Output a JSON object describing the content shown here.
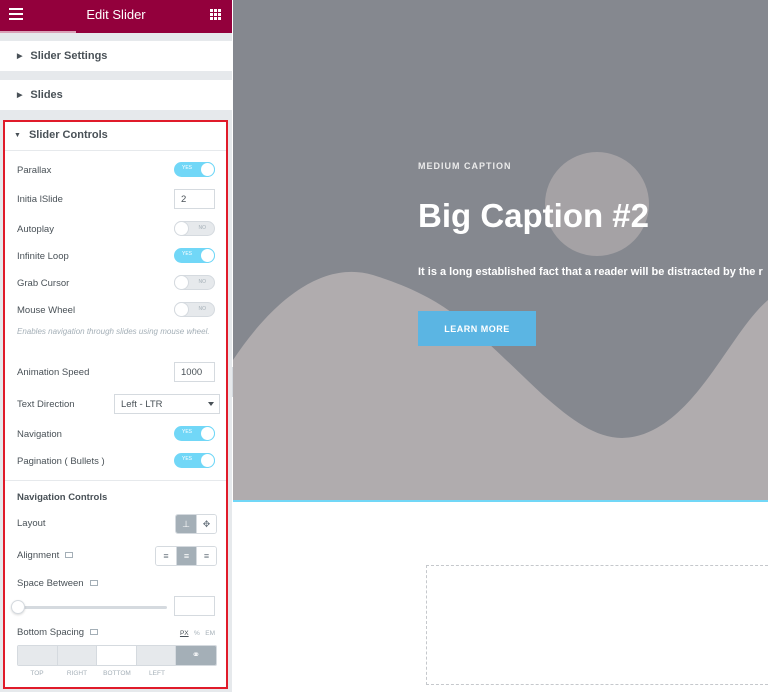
{
  "panel": {
    "title": "Edit Slider",
    "sections": {
      "settings": "Slider Settings",
      "slides": "Slides",
      "controls": "Slider Controls"
    }
  },
  "controls": {
    "parallax": {
      "label": "Parallax",
      "state": "YES"
    },
    "initial_slide": {
      "label": "Initia lSlide",
      "value": "2"
    },
    "autoplay": {
      "label": "Autoplay",
      "state": "NO"
    },
    "infinite_loop": {
      "label": "Infinite Loop",
      "state": "YES"
    },
    "grab_cursor": {
      "label": "Grab Cursor",
      "state": "NO"
    },
    "mouse_wheel": {
      "label": "Mouse Wheel",
      "state": "NO",
      "description": "Enables navigation through slides using mouse wheel."
    },
    "animation_speed": {
      "label": "Animation Speed",
      "value": "1000"
    },
    "text_direction": {
      "label": "Text Direction",
      "value": "Left - LTR"
    },
    "navigation": {
      "label": "Navigation",
      "state": "YES"
    },
    "pagination": {
      "label": "Pagination ( Bullets )",
      "state": "YES"
    }
  },
  "nav_controls": {
    "heading": "Navigation Controls",
    "layout_label": "Layout",
    "alignment_label": "Alignment",
    "space_between_label": "Space Between",
    "space_between_value": "",
    "space_between_level": 0,
    "bottom_spacing_label": "Bottom Spacing",
    "units": [
      "PX",
      "%",
      "EM"
    ],
    "selected_unit": "PX",
    "dimensions": [
      "TOP",
      "RIGHT",
      "BOTTOM",
      "LEFT"
    ]
  },
  "preview": {
    "medium_caption": "MEDIUM CAPTION",
    "big_caption": "Big Caption #2",
    "text": "It is a long established fact that a reader will be distracted by the r",
    "button": "LEARN MORE"
  },
  "colors": {
    "header": "#93003c",
    "accent": "#71d7f7",
    "highlight_border": "#e01b2a",
    "hero_bg": "#85888f",
    "hero_shape": "#b0acae",
    "button": "#5bb5e3"
  }
}
